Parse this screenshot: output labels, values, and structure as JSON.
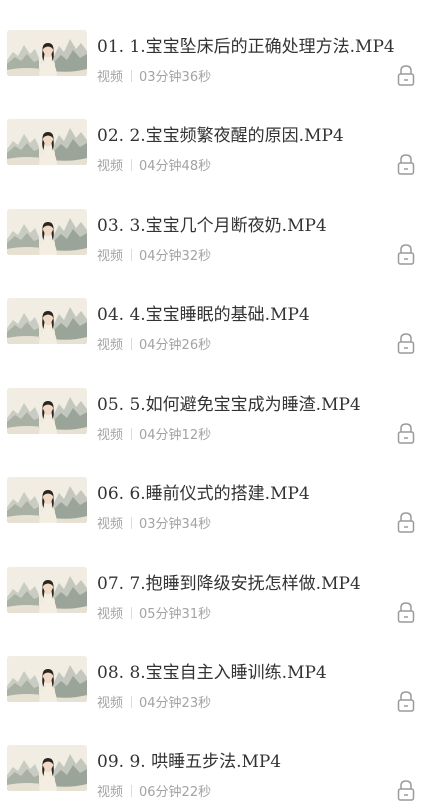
{
  "items": [
    {
      "title": "01. 1.宝宝坠床后的正确处理方法.MP4",
      "type": "视频",
      "duration": "03分钟36秒",
      "locked": true
    },
    {
      "title": "02. 2.宝宝频繁夜醒的原因.MP4",
      "type": "视频",
      "duration": "04分钟48秒",
      "locked": true
    },
    {
      "title": "03. 3.宝宝几个月断夜奶.MP4",
      "type": "视频",
      "duration": "04分钟32秒",
      "locked": true
    },
    {
      "title": "04. 4.宝宝睡眠的基础.MP4",
      "type": "视频",
      "duration": "04分钟26秒",
      "locked": true
    },
    {
      "title": "05. 5.如何避免宝宝成为睡渣.MP4",
      "type": "视频",
      "duration": "04分钟12秒",
      "locked": true
    },
    {
      "title": "06. 6.睡前仪式的搭建.MP4",
      "type": "视频",
      "duration": "03分钟34秒",
      "locked": true
    },
    {
      "title": "07. 7.抱睡到降级安抚怎样做.MP4",
      "type": "视频",
      "duration": "05分钟31秒",
      "locked": true
    },
    {
      "title": "08. 8.宝宝自主入睡训练.MP4",
      "type": "视频",
      "duration": "04分钟23秒",
      "locked": true
    },
    {
      "title": "09. 9. 哄睡五步法.MP4",
      "type": "视频",
      "duration": "06分钟22秒",
      "locked": true
    }
  ],
  "icons": {
    "thumbnail": "video-thumbnail",
    "lock": "lock-icon"
  },
  "colors": {
    "title": "#333333",
    "meta": "#a3a3a3",
    "lock": "#9a9a9a"
  }
}
